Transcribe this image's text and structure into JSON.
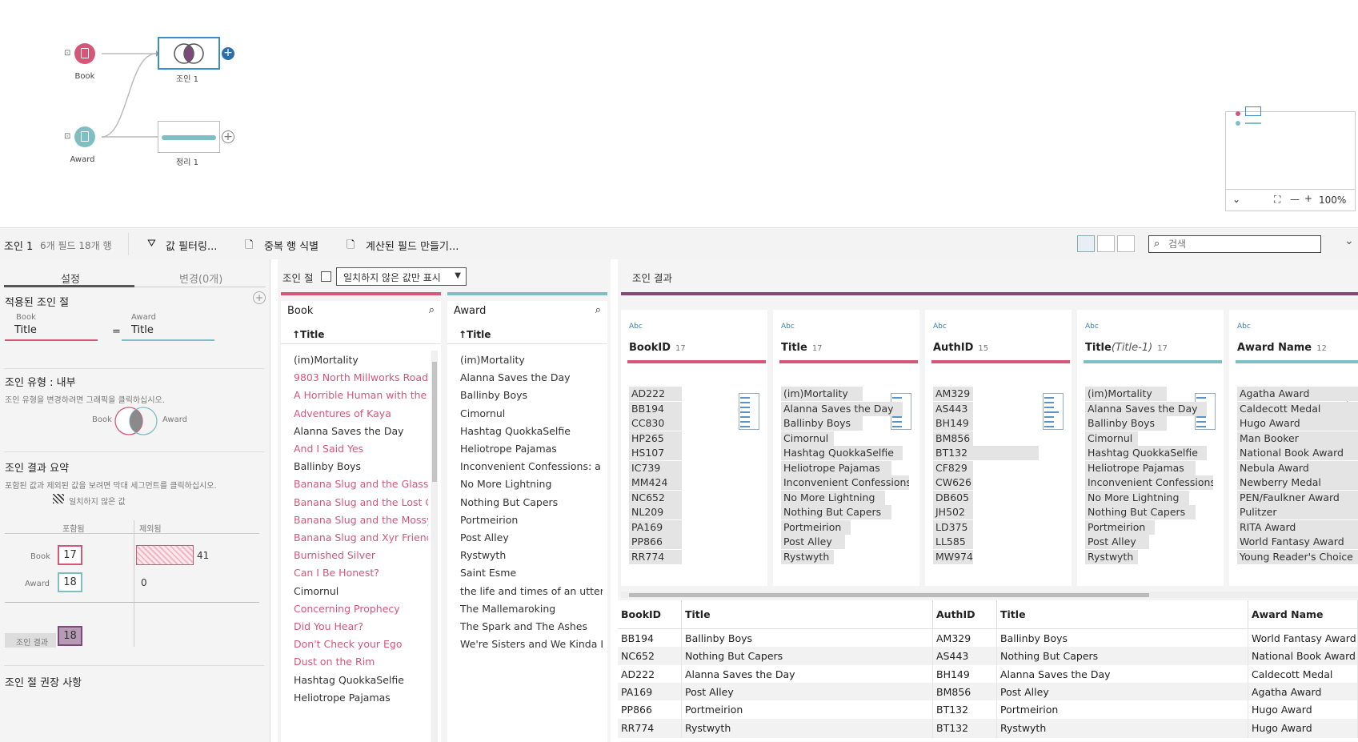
{
  "flow": {
    "nodes": [
      {
        "label": "Book",
        "color": "#d55678"
      },
      {
        "label": "Award",
        "color": "#7fbfc4"
      },
      {
        "label": "조인 1"
      },
      {
        "label": "정리 1"
      }
    ],
    "minimap_zoom": "100%"
  },
  "toolbar": {
    "step_name": "조인 1",
    "step_meta": "6개 필드  18개 행",
    "filter_label": "값 필터링...",
    "duplicate_label": "중복 행 식별",
    "calc_label": "계산된 필드 만들기...",
    "search_placeholder": "검색"
  },
  "settings": {
    "tab_settings": "설정",
    "tab_changes": "변경(0개)",
    "applied_title": "적용된 조인 절",
    "left_source": "Book",
    "right_source": "Award",
    "left_field": "Title",
    "operator": "=",
    "right_field": "Title",
    "join_type_title": "조인 유형 : 내부",
    "join_type_hint": "조인 유형을 변경하려면 그래픽을 클릭하십시오.",
    "venn_left": "Book",
    "venn_right": "Award",
    "summary_title": "조인 결과 요약",
    "summary_hint": "포함된 값과 제외된 값을 보려면 막대 세그먼트를 클릭하십시오.",
    "legend_unmatched": "일치하지 않은 값",
    "col_included": "포함됨",
    "col_excluded": "제외됨",
    "row_book": "Book",
    "row_award": "Award",
    "row_result": "조인 결과",
    "book_included": "17",
    "book_excluded": "41",
    "award_included": "18",
    "award_excluded": "0",
    "result_included": "18",
    "recommend_title": "조인 절 권장 사항"
  },
  "clause": {
    "title": "조인 절",
    "dropdown_value": "일치하지 않은 값만 표시",
    "left_header": "Book",
    "right_header": "Award",
    "sort_field": "↑Title",
    "book_items": [
      {
        "text": "(im)Mortality",
        "unmatched": false
      },
      {
        "text": "9803 North Millworks Road",
        "unmatched": true
      },
      {
        "text": "A Horrible Human with the Horns",
        "unmatched": true
      },
      {
        "text": "Adventures of Kaya",
        "unmatched": true
      },
      {
        "text": "Alanna Saves the Day",
        "unmatched": false
      },
      {
        "text": "And I Said Yes",
        "unmatched": true
      },
      {
        "text": "Ballinby Boys",
        "unmatched": false
      },
      {
        "text": "Banana Slug and the Glass Half Full",
        "unmatched": true
      },
      {
        "text": "Banana Slug and the Lost Cow",
        "unmatched": true
      },
      {
        "text": "Banana Slug and the Mossy Rock",
        "unmatched": true
      },
      {
        "text": "Banana Slug and Xyr Friends",
        "unmatched": true
      },
      {
        "text": "Burnished Silver",
        "unmatched": true
      },
      {
        "text": "Can I Be Honest?",
        "unmatched": true
      },
      {
        "text": "Cimornul",
        "unmatched": false
      },
      {
        "text": "Concerning Prophecy",
        "unmatched": true
      },
      {
        "text": "Did You Hear?",
        "unmatched": true
      },
      {
        "text": "Don't Check your Ego",
        "unmatched": true
      },
      {
        "text": "Dust on the Rim",
        "unmatched": true
      },
      {
        "text": "Hashtag QuokkaSelfie",
        "unmatched": false
      },
      {
        "text": "Heliotrope Pajamas",
        "unmatched": false
      }
    ],
    "award_items": [
      "(im)Mortality",
      "Alanna Saves the Day",
      "Ballinby Boys",
      "Cimornul",
      "Hashtag QuokkaSelfie",
      "Heliotrope Pajamas",
      "Inconvenient Confessions: a memoir",
      "No More Lightning",
      "Nothing But Capers",
      "Portmeirion",
      "Post Alley",
      "Rystwyth",
      "Saint Esme",
      "the life and times of an utterly inconsequential person",
      "The Mallemaroking",
      "The Spark and The Ashes",
      "We're Sisters and We Kinda Like Each Other"
    ]
  },
  "results": {
    "title": "조인 결과",
    "type_badge": "Abc",
    "columns": [
      {
        "name": "BookID",
        "alias": "",
        "count": "17",
        "color": "#d55678",
        "values": [
          "AD222",
          "BB194",
          "CC830",
          "HP265",
          "HS107",
          "IC739",
          "MM424",
          "NC652",
          "NL209",
          "PA169",
          "PP866",
          "RR774"
        ]
      },
      {
        "name": "Title",
        "alias": "",
        "count": "17",
        "color": "#d55678",
        "values": [
          "(im)Mortality",
          "Alanna Saves the Day",
          "Ballinby Boys",
          "Cimornul",
          "Hashtag QuokkaSelfie",
          "Heliotrope Pajamas",
          "Inconvenient Confessions",
          "No More Lightning",
          "Nothing But Capers",
          "Portmeirion",
          "Post Alley",
          "Rystwyth"
        ]
      },
      {
        "name": "AuthID",
        "alias": "",
        "count": "15",
        "color": "#d55678",
        "values": [
          "AM329",
          "AS443",
          "BH149",
          "BM856",
          "BT132",
          "CF829",
          "CW626",
          "DB605",
          "JH502",
          "LD375",
          "LL585",
          "MW974"
        ]
      },
      {
        "name": "Title",
        "alias": "(Title-1)",
        "count": "17",
        "color": "#7fbfc4",
        "values": [
          "(im)Mortality",
          "Alanna Saves the Day",
          "Ballinby Boys",
          "Cimornul",
          "Hashtag QuokkaSelfie",
          "Heliotrope Pajamas",
          "Inconvenient Confessions",
          "No More Lightning",
          "Nothing But Capers",
          "Portmeirion",
          "Post Alley",
          "Rystwyth"
        ]
      },
      {
        "name": "Award Name",
        "alias": "",
        "count": "12",
        "color": "#7fbfc4",
        "values": [
          "Agatha Award",
          "Caldecott Medal",
          "Hugo Award",
          "Man Booker",
          "National Book Award",
          "Nebula Award",
          "Newberry Medal",
          "PEN/Faulkner Award",
          "Pulitzer",
          "RITA Award",
          "World Fantasy Award",
          "Young Reader's Choice"
        ]
      }
    ],
    "grid_headers": [
      "BookID",
      "Title",
      "AuthID",
      "Title",
      "Award Name"
    ],
    "grid_rows": [
      [
        "BB194",
        "Ballinby Boys",
        "AM329",
        "Ballinby Boys",
        "World Fantasy Award"
      ],
      [
        "NC652",
        "Nothing But Capers",
        "AS443",
        "Nothing But Capers",
        "National Book Award"
      ],
      [
        "AD222",
        "Alanna Saves the Day",
        "BH149",
        "Alanna Saves the Day",
        "Caldecott Medal"
      ],
      [
        "PA169",
        "Post Alley",
        "BM856",
        "Post Alley",
        "Agatha Award"
      ],
      [
        "PP866",
        "Portmeirion",
        "BT132",
        "Portmeirion",
        "Hugo Award"
      ],
      [
        "RR774",
        "Rystwyth",
        "BT132",
        "Rystwyth",
        "Hugo Award"
      ]
    ]
  },
  "colors": {
    "book": "#d55678",
    "award": "#7fbfc4",
    "join": "#7b4a78",
    "accent": "#3a8ecb"
  }
}
